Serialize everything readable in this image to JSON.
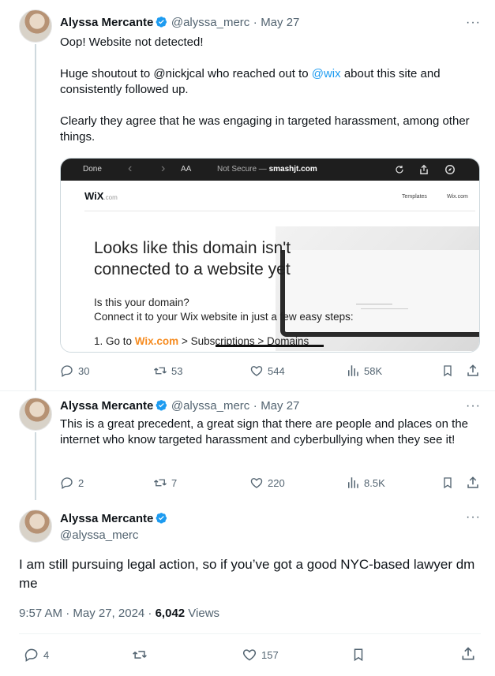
{
  "tweets": [
    {
      "name": "Alyssa Mercante",
      "handle": "@alyssa_merc",
      "date": "May 27",
      "paragraphs": {
        "p1": "Oop! Website not detected!",
        "p2_pre": "Huge shoutout to @nickjcal who reached out to ",
        "p2_link": "@wix",
        "p2_post": " about this site and consistently followed up.",
        "p3": "Clearly they agree that he was engaging in targeted harassment, among other things."
      },
      "counts": {
        "replies": "30",
        "reposts": "53",
        "likes": "544",
        "views": "58K"
      }
    },
    {
      "name": "Alyssa Mercante",
      "handle": "@alyssa_merc",
      "date": "May 27",
      "text": "This is a great precedent, a great sign that there are people and places on the internet who know targeted harassment and cyberbullying when they see it!",
      "counts": {
        "replies": "2",
        "reposts": "7",
        "likes": "220",
        "views": "8.5K"
      }
    },
    {
      "name": "Alyssa Mercante",
      "handle": "@alyssa_merc",
      "text": "I am still pursuing legal action, so if you’ve got a good NYC-based lawyer dm me",
      "timestamp": "9:57 AM · May 27, 2024 · ",
      "views_count": "6,042",
      "views_label": " Views",
      "counts": {
        "replies": "4",
        "likes": "157"
      }
    }
  ],
  "embed": {
    "browser": {
      "done": "Done",
      "back": "‹",
      "forward": "›",
      "aa": "AA",
      "not_secure": "Not Secure — ",
      "domain": "smashjt.com"
    },
    "wix_logo": "WiX",
    "wix_logo_suffix": ".com",
    "nav_templates": "Templates",
    "nav_wix": "Wix.com",
    "headline_1": "Looks like this domain isn't",
    "headline_2": "connected to a website yet",
    "sub_1": "Is this your domain?",
    "sub_2": "Connect it to your Wix website in just a few easy steps:",
    "step_pre": "1. Go to ",
    "step_link": "Wix.com",
    "step_post": " > Subscriptions > Domains"
  },
  "menu": {
    "more": "···"
  }
}
